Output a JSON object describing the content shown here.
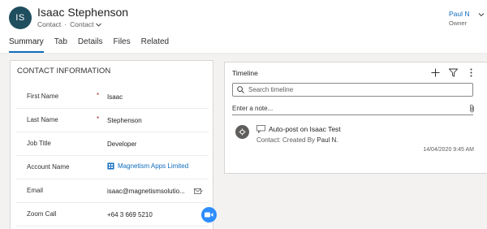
{
  "record": {
    "initials": "IS",
    "name": "Isaac Stephenson",
    "entity": "Contact",
    "separator": "·",
    "form": "Contact",
    "owner_name": "Paul N",
    "owner_label": "Owner"
  },
  "tabs": [
    {
      "label": "Summary",
      "active": true
    },
    {
      "label": "Tab",
      "active": false
    },
    {
      "label": "Details",
      "active": false
    },
    {
      "label": "Files",
      "active": false
    },
    {
      "label": "Related",
      "active": false
    }
  ],
  "contact": {
    "section_title": "CONTACT INFORMATION",
    "required_marker": "*",
    "fields": [
      {
        "label": "First Name",
        "value": "Isaac",
        "required": true
      },
      {
        "label": "Last Name",
        "value": "Stephenson",
        "required": true
      },
      {
        "label": "Job Title",
        "value": "Developer",
        "required": false
      },
      {
        "label": "Account Name",
        "value": "Magnetism Apps Limited",
        "required": false
      },
      {
        "label": "Email",
        "value": "isaac@magnetismsolutio...",
        "required": false
      },
      {
        "label": "Zoom Call",
        "value": "+64 3 669 5210",
        "required": false
      }
    ]
  },
  "timeline": {
    "title": "Timeline",
    "search_placeholder": "Search timeline",
    "note_placeholder": "Enter a note...",
    "post": {
      "title": "Auto-post on Isaac Test",
      "sub_prefix": "Contact: Created By",
      "sub_author": "Paul N.",
      "timestamp": "14/04/2020 9:45 AM"
    }
  },
  "icons": {
    "add": "plus-icon",
    "filter": "filter-icon",
    "more": "more-vertical-icon",
    "search": "search-icon",
    "attach": "paperclip-icon",
    "email": "email-compose-icon",
    "zoom": "video-camera-icon",
    "account": "account-icon",
    "post_type": "post-icon",
    "post_avatar": "system-avatar-icon"
  },
  "colors": {
    "accent": "#0f6cbd",
    "avatar_bg": "#1f4e5f",
    "zoom": "#2d8cff",
    "required": "#a4262c",
    "page_bg": "#f3f2f1"
  }
}
